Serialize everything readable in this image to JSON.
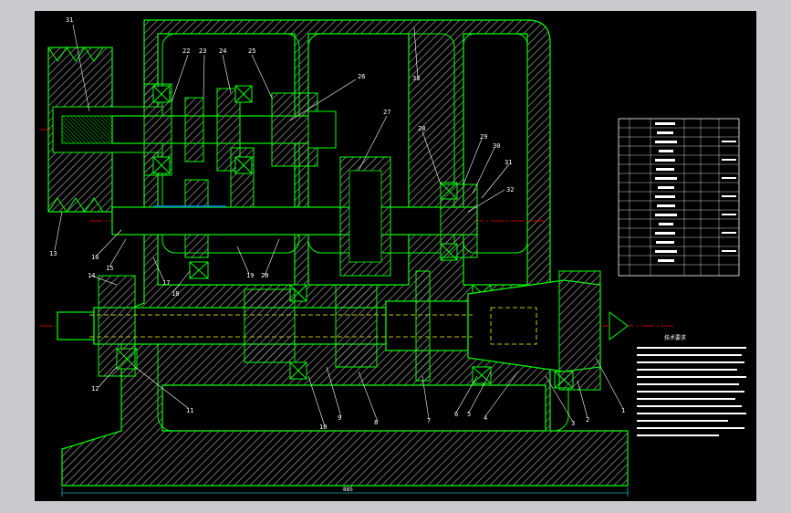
{
  "drawing": {
    "colors": {
      "background": "#000000",
      "frame": "#c8cacd",
      "outline": "#00ff00",
      "hatch": "#8a8a8a",
      "centerline": "#ff0000",
      "hidden": "#ffff00",
      "leader": "#ffffff",
      "bearing": "#00ff00",
      "shaft_fill": "#1a2a1a"
    },
    "part_numbers": [
      "31",
      "22",
      "23",
      "24",
      "25",
      "26",
      "27",
      "28",
      "29",
      "30",
      "31",
      "32",
      "33",
      "13",
      "16",
      "15",
      "17",
      "18",
      "19",
      "20",
      "14",
      "12",
      "11",
      "10",
      "9",
      "8",
      "7",
      "6",
      "5",
      "4",
      "3",
      "2",
      "1"
    ],
    "notes_title": "技术要求",
    "dimension_label": "885"
  }
}
